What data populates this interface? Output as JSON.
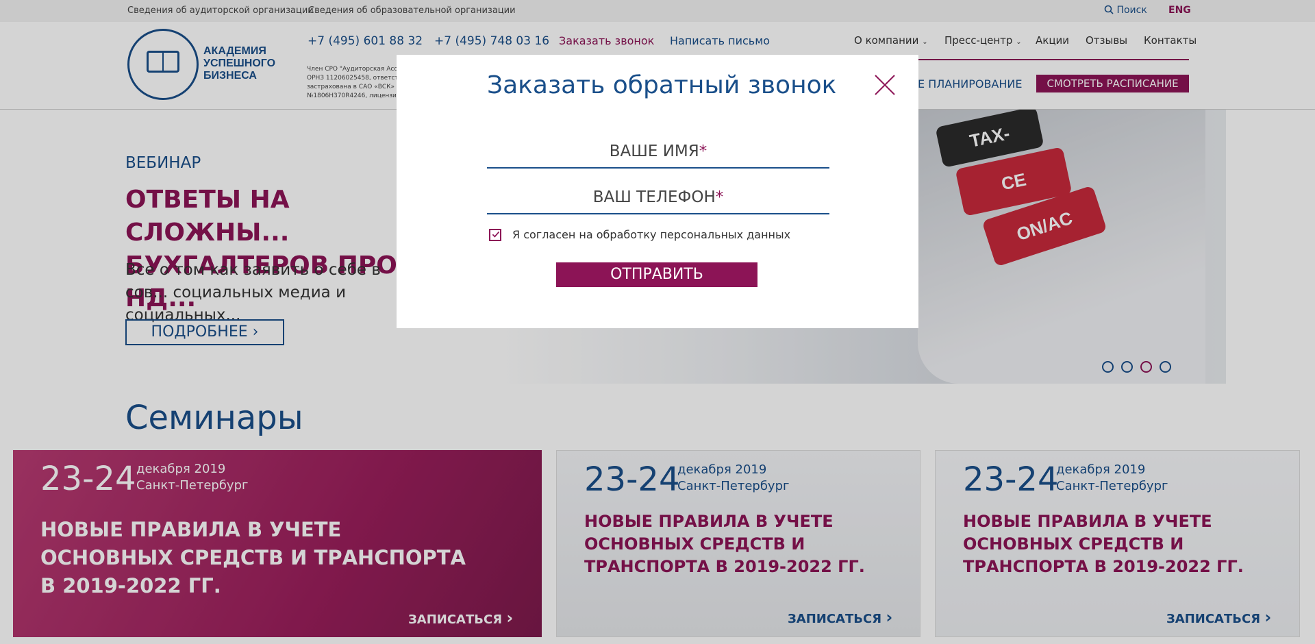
{
  "topbar": {
    "link1": "Сведения об аудиторской организации",
    "link2": "Сведения об образовательной организации",
    "search": "Поиск",
    "lang": "ENG"
  },
  "header": {
    "logo_line1": "АКАДЕМИЯ",
    "logo_line2": "УСПЕШНОГО",
    "logo_line3": "БИЗНЕСА",
    "phone1": "+7 (495) 601 88 32",
    "phone2": "+7 (495) 748 03 16",
    "callback": "Заказать звонок",
    "write": "Написать письмо",
    "sro": "Член СРО \"Аудиторская Асс... ОРНЗ 11206025458, ответст... застрахована в САО «ВСК» №1806H370R4246, лицензи...",
    "nav": [
      "О компании",
      "Пресс-центр",
      "Акции",
      "Отзывы",
      "Контакты"
    ],
    "planning": "Е ПЛАНИРОВАНИЕ",
    "schedule": "СМОТРЕТЬ РАСПИСАНИЕ"
  },
  "hero": {
    "kicker": "ВЕБИНАР",
    "title": "ОТВЕТЫ НА СЛОЖНЫ... БУХГАЛТЕРОВ ПРО НД...",
    "subtitle": "Все о том как заявить о себе в сов... социальных медиа и социальных...",
    "more": "ПОДРОБНЕЕ",
    "keys": [
      "TAX-",
      "CE",
      "ON/AC"
    ]
  },
  "seminars": {
    "title": "Семинары",
    "cards": [
      {
        "date": "23-24",
        "month": "декабря 2019",
        "city": "Санкт-Петербург",
        "title": "НОВЫЕ ПРАВИЛА В УЧЕТЕ ОСНОВНЫХ СРЕДСТВ И ТРАНСПОРТА В 2019-2022 ГГ.",
        "signup": "ЗАПИСАТЬСЯ"
      },
      {
        "date": "23-24",
        "month": "декабря 2019",
        "city": "Санкт-Петербург",
        "title": "НОВЫЕ ПРАВИЛА В УЧЕТЕ ОСНОВНЫХ СРЕДСТВ И ТРАНСПОРТА В 2019-2022 ГГ.",
        "signup": "ЗАПИСАТЬСЯ"
      },
      {
        "date": "23-24",
        "month": "декабря 2019",
        "city": "Санкт-Петербург",
        "title": "НОВЫЕ ПРАВИЛА В УЧЕТЕ ОСНОВНЫХ СРЕДСТВ И ТРАНСПОРТА В 2019-2022 ГГ.",
        "signup": "ЗАПИСАТЬСЯ"
      }
    ]
  },
  "modal": {
    "title": "Заказать обратный звонок",
    "name_placeholder": "ВАШЕ ИМЯ",
    "phone_placeholder": "ВАШ ТЕЛЕФОН",
    "required_mark": "*",
    "consent": "Я согласен на обработку персональных данных",
    "consent_checked": true,
    "submit": "ОТПРАВИТЬ"
  },
  "colors": {
    "brand_blue": "#1a4f8a",
    "brand_magenta": "#8c1456"
  }
}
